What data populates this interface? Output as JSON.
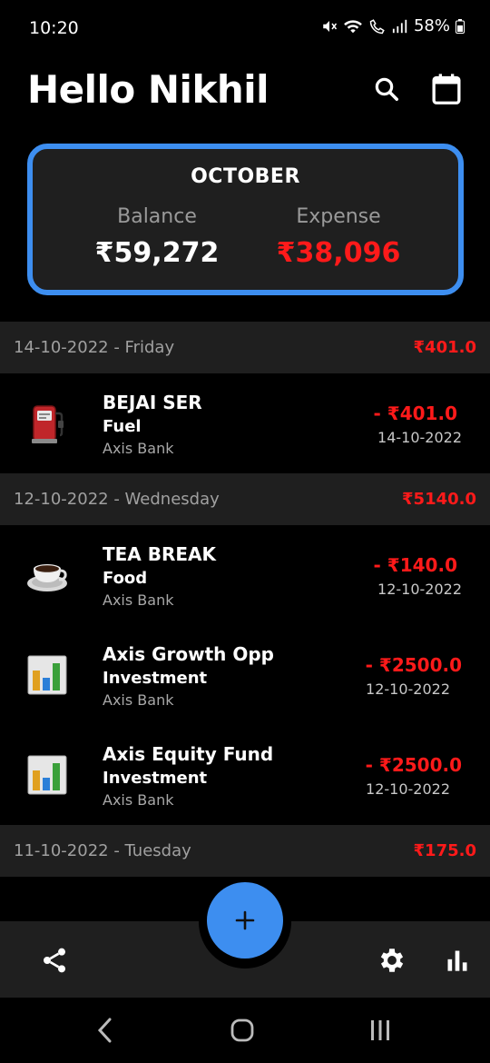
{
  "status_bar": {
    "time": "10:20",
    "battery": "58%"
  },
  "header": {
    "greeting": "Hello Nikhil"
  },
  "summary": {
    "month": "OCTOBER",
    "balance_label": "Balance",
    "balance_value": "₹59,272",
    "expense_label": "Expense",
    "expense_value": "₹38,096"
  },
  "days": [
    {
      "date": "14-10-2022 - Friday",
      "total": "₹401.0",
      "transactions": [
        {
          "title": "BEJAI SER",
          "category": "Fuel",
          "bank": "Axis Bank",
          "amount": "- ₹401.0",
          "date": "14-10-2022",
          "icon": "fuel-pump-icon"
        }
      ]
    },
    {
      "date": "12-10-2022 - Wednesday",
      "total": "₹5140.0",
      "transactions": [
        {
          "title": "TEA BREAK",
          "category": "Food",
          "bank": "Axis Bank",
          "amount": "- ₹140.0",
          "date": "12-10-2022",
          "icon": "coffee-cup-icon"
        },
        {
          "title": "Axis Growth Opp",
          "category": "Investment",
          "bank": "Axis Bank",
          "amount": "- ₹2500.0",
          "date": "12-10-2022",
          "icon": "bar-chart-icon"
        },
        {
          "title": "Axis Equity Fund",
          "category": "Investment",
          "bank": "Axis Bank",
          "amount": "- ₹2500.0",
          "date": "12-10-2022",
          "icon": "bar-chart-icon"
        }
      ]
    },
    {
      "date": "11-10-2022 - Tuesday",
      "total": "₹175.0",
      "transactions": []
    }
  ],
  "colors": {
    "accent": "#3d8ef0",
    "expense_red": "#ff1a1a",
    "card_bg": "#1f1f1f",
    "background": "#000000"
  },
  "icons": {
    "header": [
      "search-icon",
      "calendar-icon"
    ],
    "bottom_bar": [
      "share-icon",
      "add-icon",
      "settings-icon",
      "stats-icon"
    ],
    "nav_bar": [
      "back-icon",
      "home-icon",
      "recents-icon"
    ]
  }
}
